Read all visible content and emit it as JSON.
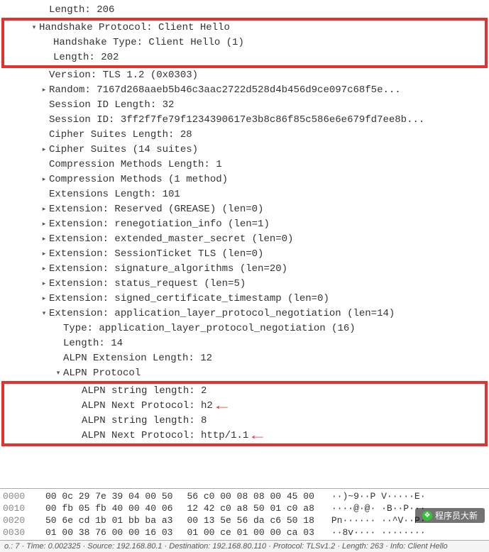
{
  "top_line": "Length: 206",
  "box_top": {
    "l1": "Handshake Protocol: Client Hello",
    "l2": "Handshake Type: Client Hello (1)",
    "l3": "Length: 202"
  },
  "mid": {
    "version": "Version: TLS 1.2 (0x0303)",
    "random": "Random: 7167d268aaeb5b46c3aac2722d528d4b456d9ce097c68f5e...",
    "sid_len": "Session ID Length: 32",
    "sid": "Session ID: 3ff2f7fe79f1234390617e3b8c86f85c586e6e679fd7ee8b...",
    "cs_len": "Cipher Suites Length: 28",
    "cs": "Cipher Suites (14 suites)",
    "cm_len": "Compression Methods Length: 1",
    "cm": "Compression Methods (1 method)",
    "ext_len": "Extensions Length: 101",
    "ext1": "Extension: Reserved (GREASE) (len=0)",
    "ext2": "Extension: renegotiation_info (len=1)",
    "ext3": "Extension: extended_master_secret (len=0)",
    "ext4": "Extension: SessionTicket TLS (len=0)",
    "ext5": "Extension: signature_algorithms (len=20)",
    "ext6": "Extension: status_request (len=5)",
    "ext7": "Extension: signed_certificate_timestamp (len=0)",
    "ext8": "Extension: application_layer_protocol_negotiation (len=14)",
    "alpn_type": "Type: application_layer_protocol_negotiation (16)",
    "alpn_len": "Length: 14",
    "alpn_ext_len": "ALPN Extension Length: 12",
    "alpn_proto": "ALPN Protocol"
  },
  "box_bot": {
    "l1": "ALPN string length: 2",
    "l2": "ALPN Next Protocol: h2",
    "l3": "ALPN string length: 8",
    "l4": "ALPN Next Protocol: http/1.1"
  },
  "hex": {
    "rows": [
      {
        "off": "0000",
        "b1": "00 0c 29 7e 39 04 00 50",
        "b2": "56 c0 00 08 08 00 45 00",
        "asc": "··)~9··P V·····E·"
      },
      {
        "off": "0010",
        "b1": "00 fb 05 fb 40 00 40 06",
        "b2": "12 42 c0 a8 50 01 c0 a8",
        "asc": "····@·@· ·B··P···"
      },
      {
        "off": "0020",
        "b1": "50 6e cd 1b 01 bb ba a3",
        "b2": "00 13 5e 56 da c6 50 18",
        "asc": "Pn······ ··^V··P·"
      },
      {
        "off": "0030",
        "b1": "01 00 38 76 00 00 16 03",
        "b2": "01 00 ce 01 00 00 ca 03",
        "asc": "··8v···· ········"
      }
    ]
  },
  "status": "o.: 7 · Time: 0.002325 · Source: 192.168.80.1 · Destination: 192.168.80.110 · Protocol: TLSv1.2 · Length: 263 · Info: Client Hello",
  "watermark": "程序员大新"
}
